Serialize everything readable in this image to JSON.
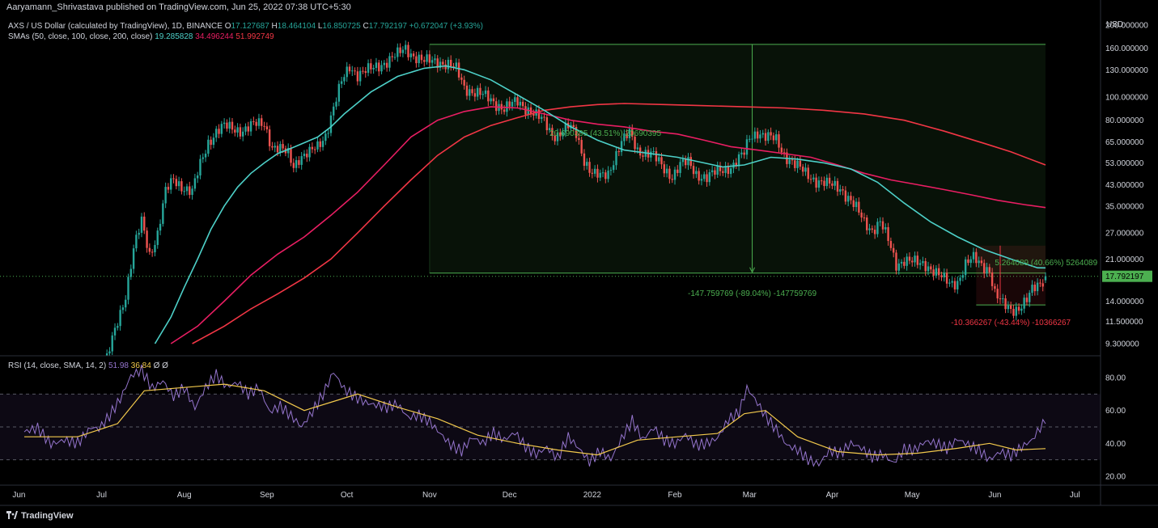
{
  "header": {
    "publisher": "Aaryamann_Shrivastava published on TradingView.com, Jun 25, 2022 07:38 UTC+5:30",
    "symbol": "AXS / US Dollar (calculated by TradingView), 1D, BINANCE",
    "o_label": "O",
    "o_value": "17.127687",
    "h_label": "H",
    "h_value": "18.464104",
    "l_label": "L",
    "l_value": "16.850725",
    "c_label": "C",
    "c_value": "17.792197",
    "change": "+0.672047 (+3.93%)",
    "sma_label": "SMAs (50, close, 100, close, 200, close)",
    "sma50": "19.285828",
    "sma100": "34.496244",
    "sma200": "51.992749",
    "rsi_label": "RSI (14, close, SMA, 14, 2)",
    "rsi_value": "51.98",
    "rsi_sma": "36.84",
    "rsi_extra": "Ø Ø"
  },
  "footer": {
    "brand": "TradingView"
  },
  "colors": {
    "up": "#26a69a",
    "down": "#ef5350",
    "sma50": "#4dd0c8",
    "sma100": "#e91e63",
    "sma200": "#f23645",
    "rsi": "#9575cd",
    "rsi_sma": "#f2c94c",
    "measure": "#4caf50",
    "measure_neg": "#f23645",
    "price_tag": "#4caf50"
  },
  "chart_data": [
    {
      "type": "candlestick",
      "scale": "log",
      "currency": "USD",
      "y_ticks": [
        200,
        160,
        130,
        100,
        80,
        65,
        53,
        43,
        35,
        27,
        21,
        17.792197,
        14,
        11.5,
        9.3
      ],
      "y_tick_labels": [
        "200.000000",
        "160.000000",
        "130.000000",
        "100.000000",
        "80.000000",
        "65.000000",
        "53.000000",
        "43.000000",
        "35.000000",
        "27.000000",
        "21.000000",
        "17.792197",
        "14.000000",
        "11.500000",
        "9.300000"
      ],
      "last_price": "17.792197",
      "x_labels": [
        "Jun",
        "Jul",
        "Aug",
        "Sep",
        "Oct",
        "Nov",
        "Dec",
        "2022",
        "Feb",
        "Mar",
        "Apr",
        "May",
        "Jun",
        "Jul"
      ],
      "close_path": [
        [
          0,
          6.5
        ],
        [
          10,
          5.6
        ],
        [
          20,
          5.4
        ],
        [
          28,
          6.2
        ],
        [
          31,
          8.0
        ],
        [
          35,
          11.5
        ],
        [
          38,
          15
        ],
        [
          41,
          23
        ],
        [
          44,
          30
        ],
        [
          47,
          22
        ],
        [
          50,
          27
        ],
        [
          53,
          40
        ],
        [
          56,
          45
        ],
        [
          60,
          42
        ],
        [
          63,
          40
        ],
        [
          66,
          52
        ],
        [
          69,
          65
        ],
        [
          72,
          72
        ],
        [
          75,
          75
        ],
        [
          78,
          74
        ],
        [
          82,
          73
        ],
        [
          86,
          76
        ],
        [
          90,
          78
        ],
        [
          93,
          62
        ],
        [
          96,
          60
        ],
        [
          99,
          58
        ],
        [
          101,
          52
        ],
        [
          103,
          56
        ],
        [
          107,
          58
        ],
        [
          110,
          62
        ],
        [
          113,
          70
        ],
        [
          116,
          90
        ],
        [
          119,
          115
        ],
        [
          122,
          135
        ],
        [
          125,
          125
        ],
        [
          130,
          130
        ],
        [
          135,
          140
        ],
        [
          140,
          150
        ],
        [
          143,
          160
        ],
        [
          146,
          150
        ],
        [
          150,
          140
        ],
        [
          155,
          142
        ],
        [
          159,
          137
        ],
        [
          162,
          130
        ],
        [
          165,
          110
        ],
        [
          170,
          104
        ],
        [
          175,
          97
        ],
        [
          180,
          90
        ],
        [
          185,
          95
        ],
        [
          190,
          88
        ],
        [
          195,
          78
        ],
        [
          198,
          70
        ],
        [
          200,
          70
        ],
        [
          204,
          75
        ],
        [
          207,
          70
        ],
        [
          210,
          55
        ],
        [
          213,
          48
        ],
        [
          216,
          46
        ],
        [
          219,
          48
        ],
        [
          221,
          55
        ],
        [
          224,
          65
        ],
        [
          227,
          70
        ],
        [
          230,
          60
        ],
        [
          235,
          58
        ],
        [
          240,
          50
        ],
        [
          243,
          47
        ],
        [
          246,
          52
        ],
        [
          249,
          53
        ],
        [
          252,
          48
        ],
        [
          256,
          46
        ],
        [
          262,
          50
        ],
        [
          266,
          52
        ],
        [
          270,
          58
        ],
        [
          272,
          68
        ],
        [
          275,
          72
        ],
        [
          278,
          68
        ],
        [
          282,
          66
        ],
        [
          285,
          58
        ],
        [
          289,
          52
        ],
        [
          293,
          48
        ],
        [
          297,
          45
        ],
        [
          301,
          43
        ],
        [
          306,
          42
        ],
        [
          309,
          38
        ],
        [
          312,
          34
        ],
        [
          315,
          30
        ],
        [
          318,
          28
        ],
        [
          321,
          30
        ],
        [
          324,
          25
        ],
        [
          327,
          20
        ],
        [
          330,
          21
        ],
        [
          335,
          20
        ],
        [
          338,
          20
        ],
        [
          341,
          19
        ],
        [
          344,
          17.5
        ],
        [
          347,
          16.5
        ],
        [
          350,
          17
        ],
        [
          353,
          20
        ],
        [
          356,
          21
        ],
        [
          359,
          20
        ],
        [
          362,
          19
        ],
        [
          364,
          15
        ],
        [
          367,
          13.5
        ],
        [
          370,
          13
        ],
        [
          373,
          13.2
        ],
        [
          376,
          14
        ],
        [
          378,
          15.5
        ],
        [
          381,
          16.8
        ],
        [
          383,
          17.79
        ]
      ],
      "sma50": [
        [
          49,
          9.3
        ],
        [
          55,
          12
        ],
        [
          60,
          16
        ],
        [
          65,
          21
        ],
        [
          70,
          28
        ],
        [
          75,
          35
        ],
        [
          80,
          42
        ],
        [
          85,
          48
        ],
        [
          90,
          53
        ],
        [
          95,
          58
        ],
        [
          100,
          61
        ],
        [
          110,
          68
        ],
        [
          115,
          75
        ],
        [
          120,
          85
        ],
        [
          130,
          105
        ],
        [
          140,
          122
        ],
        [
          150,
          132
        ],
        [
          158,
          135
        ],
        [
          165,
          130
        ],
        [
          175,
          118
        ],
        [
          185,
          102
        ],
        [
          195,
          88
        ],
        [
          205,
          75
        ],
        [
          215,
          66
        ],
        [
          225,
          60
        ],
        [
          235,
          58
        ],
        [
          245,
          56
        ],
        [
          255,
          53
        ],
        [
          262,
          51
        ],
        [
          270,
          52
        ],
        [
          280,
          56
        ],
        [
          290,
          55
        ],
        [
          300,
          53
        ],
        [
          310,
          50
        ],
        [
          320,
          44
        ],
        [
          330,
          36
        ],
        [
          340,
          30
        ],
        [
          350,
          26
        ],
        [
          360,
          23
        ],
        [
          370,
          21
        ],
        [
          380,
          19.3
        ],
        [
          383,
          19.29
        ]
      ],
      "sma100": [
        [
          55,
          9.3
        ],
        [
          65,
          11
        ],
        [
          75,
          14
        ],
        [
          85,
          18
        ],
        [
          95,
          22
        ],
        [
          105,
          26
        ],
        [
          115,
          32
        ],
        [
          125,
          40
        ],
        [
          135,
          52
        ],
        [
          145,
          68
        ],
        [
          155,
          80
        ],
        [
          165,
          87
        ],
        [
          175,
          91
        ],
        [
          185,
          90
        ],
        [
          195,
          85
        ],
        [
          205,
          80
        ],
        [
          215,
          77
        ],
        [
          225,
          75
        ],
        [
          235,
          72
        ],
        [
          245,
          70
        ],
        [
          255,
          66
        ],
        [
          265,
          62
        ],
        [
          275,
          60
        ],
        [
          285,
          58
        ],
        [
          295,
          56
        ],
        [
          305,
          52
        ],
        [
          315,
          48
        ],
        [
          325,
          45
        ],
        [
          335,
          43
        ],
        [
          345,
          41
        ],
        [
          355,
          39
        ],
        [
          365,
          37
        ],
        [
          375,
          35.5
        ],
        [
          383,
          34.5
        ]
      ],
      "sma200": [
        [
          63,
          9.3
        ],
        [
          75,
          11
        ],
        [
          85,
          13
        ],
        [
          95,
          15
        ],
        [
          105,
          17.5
        ],
        [
          115,
          21
        ],
        [
          125,
          27
        ],
        [
          135,
          35
        ],
        [
          145,
          45
        ],
        [
          155,
          57
        ],
        [
          165,
          68
        ],
        [
          175,
          76
        ],
        [
          185,
          82
        ],
        [
          195,
          88
        ],
        [
          205,
          91
        ],
        [
          215,
          93
        ],
        [
          225,
          94
        ],
        [
          240,
          93
        ],
        [
          255,
          92
        ],
        [
          270,
          91
        ],
        [
          285,
          90
        ],
        [
          300,
          88
        ],
        [
          315,
          85
        ],
        [
          330,
          80
        ],
        [
          345,
          72
        ],
        [
          360,
          64
        ],
        [
          370,
          59
        ],
        [
          383,
          52
        ]
      ],
      "annotations": [
        {
          "text": "20.690395 (43.51%) 20690395",
          "color": "#4caf50"
        },
        {
          "text": "-147.759769 (-89.04%) -147759769",
          "color": "#4caf50"
        },
        {
          "text": "5.264089 (40.66%) 5264089",
          "color": "#4caf50"
        },
        {
          "text": "-10.366267 (-43.44%) -10366267",
          "color": "#f23645"
        }
      ]
    },
    {
      "type": "line",
      "title": "RSI (14, close, SMA, 14, 2)",
      "ylim": [
        15,
        90
      ],
      "y_ticks": [
        80,
        60,
        40,
        20
      ],
      "y_tick_labels": [
        "80.00",
        "60.00",
        "40.00",
        "20.00"
      ],
      "bands": [
        30,
        50,
        70
      ],
      "rsi": [
        [
          0,
          45
        ],
        [
          5,
          48
        ],
        [
          10,
          40
        ],
        [
          15,
          44
        ],
        [
          20,
          42
        ],
        [
          25,
          50
        ],
        [
          28,
          48
        ],
        [
          32,
          55
        ],
        [
          36,
          65
        ],
        [
          40,
          80
        ],
        [
          44,
          85
        ],
        [
          48,
          75
        ],
        [
          52,
          80
        ],
        [
          56,
          70
        ],
        [
          60,
          74
        ],
        [
          64,
          60
        ],
        [
          68,
          72
        ],
        [
          72,
          80
        ],
        [
          76,
          74
        ],
        [
          80,
          78
        ],
        [
          84,
          72
        ],
        [
          88,
          76
        ],
        [
          92,
          60
        ],
        [
          96,
          62
        ],
        [
          100,
          55
        ],
        [
          104,
          48
        ],
        [
          108,
          58
        ],
        [
          112,
          70
        ],
        [
          116,
          85
        ],
        [
          120,
          75
        ],
        [
          124,
          70
        ],
        [
          128,
          65
        ],
        [
          132,
          62
        ],
        [
          136,
          60
        ],
        [
          140,
          62
        ],
        [
          144,
          55
        ],
        [
          148,
          58
        ],
        [
          152,
          55
        ],
        [
          156,
          48
        ],
        [
          160,
          40
        ],
        [
          164,
          35
        ],
        [
          168,
          42
        ],
        [
          172,
          38
        ],
        [
          176,
          45
        ],
        [
          180,
          42
        ],
        [
          184,
          48
        ],
        [
          188,
          40
        ],
        [
          192,
          35
        ],
        [
          196,
          38
        ],
        [
          200,
          30
        ],
        [
          204,
          42
        ],
        [
          208,
          35
        ],
        [
          212,
          28
        ],
        [
          216,
          36
        ],
        [
          220,
          32
        ],
        [
          224,
          45
        ],
        [
          228,
          55
        ],
        [
          232,
          42
        ],
        [
          236,
          48
        ],
        [
          240,
          40
        ],
        [
          244,
          38
        ],
        [
          248,
          45
        ],
        [
          252,
          40
        ],
        [
          256,
          42
        ],
        [
          260,
          45
        ],
        [
          264,
          55
        ],
        [
          268,
          58
        ],
        [
          271,
          72
        ],
        [
          274,
          65
        ],
        [
          278,
          55
        ],
        [
          282,
          48
        ],
        [
          286,
          40
        ],
        [
          290,
          38
        ],
        [
          294,
          32
        ],
        [
          298,
          28
        ],
        [
          302,
          35
        ],
        [
          306,
          32
        ],
        [
          310,
          38
        ],
        [
          314,
          36
        ],
        [
          318,
          32
        ],
        [
          322,
          35
        ],
        [
          326,
          30
        ],
        [
          330,
          38
        ],
        [
          334,
          36
        ],
        [
          338,
          40
        ],
        [
          342,
          38
        ],
        [
          346,
          35
        ],
        [
          350,
          42
        ],
        [
          354,
          40
        ],
        [
          358,
          38
        ],
        [
          362,
          32
        ],
        [
          366,
          36
        ],
        [
          370,
          32
        ],
        [
          374,
          36
        ],
        [
          378,
          40
        ],
        [
          381,
          48
        ],
        [
          383,
          51.98
        ]
      ],
      "rsi_sma": [
        [
          0,
          44
        ],
        [
          20,
          44
        ],
        [
          35,
          52
        ],
        [
          45,
          72
        ],
        [
          60,
          74
        ],
        [
          75,
          76
        ],
        [
          90,
          72
        ],
        [
          105,
          60
        ],
        [
          115,
          65
        ],
        [
          125,
          70
        ],
        [
          140,
          62
        ],
        [
          155,
          55
        ],
        [
          170,
          45
        ],
        [
          185,
          40
        ],
        [
          200,
          36
        ],
        [
          215,
          33
        ],
        [
          230,
          42
        ],
        [
          245,
          44
        ],
        [
          260,
          46
        ],
        [
          270,
          58
        ],
        [
          278,
          60
        ],
        [
          290,
          44
        ],
        [
          305,
          35
        ],
        [
          320,
          33
        ],
        [
          335,
          34
        ],
        [
          350,
          37
        ],
        [
          362,
          40
        ],
        [
          372,
          36
        ],
        [
          383,
          36.84
        ]
      ]
    }
  ]
}
